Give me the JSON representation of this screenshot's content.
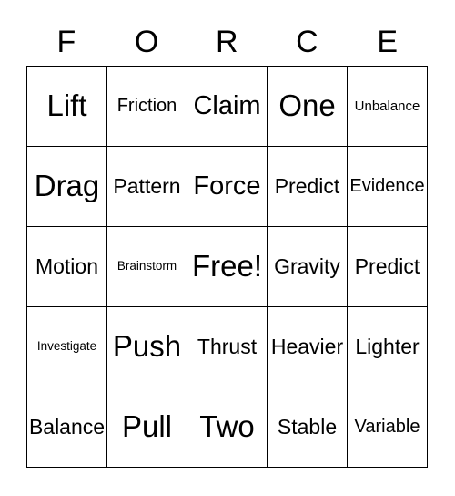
{
  "card": {
    "title_letters": [
      "F",
      "O",
      "R",
      "C",
      "E"
    ],
    "columns": 5,
    "rows": 5,
    "colors": {
      "background": "#ffffff",
      "text": "#000000",
      "border": "#000000"
    },
    "cells": [
      [
        {
          "label": "Lift",
          "size": "xl"
        },
        {
          "label": "Friction",
          "size": "sm"
        },
        {
          "label": "Claim",
          "size": "lg"
        },
        {
          "label": "One",
          "size": "xl"
        },
        {
          "label": "Unbalance",
          "size": "xs"
        }
      ],
      [
        {
          "label": "Drag",
          "size": "xl"
        },
        {
          "label": "Pattern",
          "size": "md"
        },
        {
          "label": "Force",
          "size": "lg"
        },
        {
          "label": "Predict",
          "size": "md"
        },
        {
          "label": "Evidence",
          "size": "sm"
        }
      ],
      [
        {
          "label": "Motion",
          "size": "md"
        },
        {
          "label": "Brainstorm",
          "size": "xxs"
        },
        {
          "label": "Free!",
          "size": "xl"
        },
        {
          "label": "Gravity",
          "size": "md"
        },
        {
          "label": "Predict",
          "size": "md"
        }
      ],
      [
        {
          "label": "Investigate",
          "size": "xxs"
        },
        {
          "label": "Push",
          "size": "xl"
        },
        {
          "label": "Thrust",
          "size": "md"
        },
        {
          "label": "Heavier",
          "size": "md"
        },
        {
          "label": "Lighter",
          "size": "md"
        }
      ],
      [
        {
          "label": "Balance",
          "size": "md"
        },
        {
          "label": "Pull",
          "size": "xl"
        },
        {
          "label": "Two",
          "size": "xl"
        },
        {
          "label": "Stable",
          "size": "md"
        },
        {
          "label": "Variable",
          "size": "sm"
        }
      ]
    ]
  }
}
